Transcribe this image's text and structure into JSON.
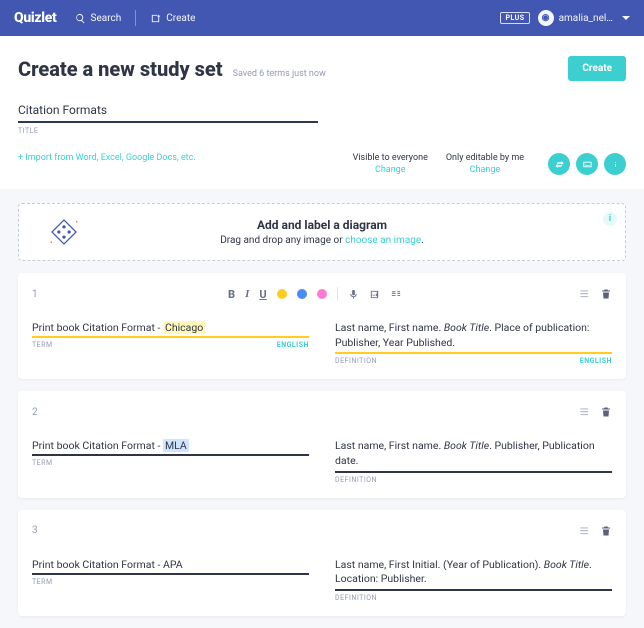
{
  "topbar": {
    "brand": "Quizlet",
    "search": "Search",
    "create": "Create",
    "plus_badge": "PLUS",
    "username": "amalia_nel…"
  },
  "header": {
    "title": "Create a new study set",
    "saved": "Saved 6 terms just now",
    "create_button": "Create"
  },
  "title_field": {
    "value": "Citation Formats",
    "label": "TITLE"
  },
  "options": {
    "import_link": "+ Import from Word, Excel, Google Docs, etc.",
    "visibility": {
      "label": "Visible to everyone",
      "action": "Change"
    },
    "editable": {
      "label": "Only editable by me",
      "action": "Change"
    }
  },
  "diagram": {
    "headline": "Add and label a diagram",
    "sub_a": "Drag and drop any image or ",
    "sub_link": "choose an image",
    "sub_b": "."
  },
  "labels": {
    "term": "TERM",
    "definition": "DEFINITION",
    "lang": "ENGLISH"
  },
  "cards": [
    {
      "n": "1",
      "term_prefix": "Print book Citation Format - ",
      "term_hl": "Chicago",
      "hl_style": "y",
      "active": true,
      "def_a": "Last name, First name. ",
      "def_em": "Book Title",
      "def_b": ". Place of publication: Publisher, Year Published."
    },
    {
      "n": "2",
      "term_prefix": "Print book Citation Format - ",
      "term_hl": "MLA",
      "hl_style": "b",
      "active": false,
      "def_a": "Last name, First name. ",
      "def_em": "Book Title",
      "def_b": ". Publisher, Publication date."
    },
    {
      "n": "3",
      "term_prefix": "Print book Citation Format - ",
      "term_hl": "APA",
      "hl_style": "",
      "active": false,
      "def_a": "Last name, First Initial. (Year of Publication). ",
      "def_em": "Book Title",
      "def_b": ". Location: Publisher."
    }
  ],
  "toolbar_items": [
    "B",
    "I",
    "U"
  ]
}
